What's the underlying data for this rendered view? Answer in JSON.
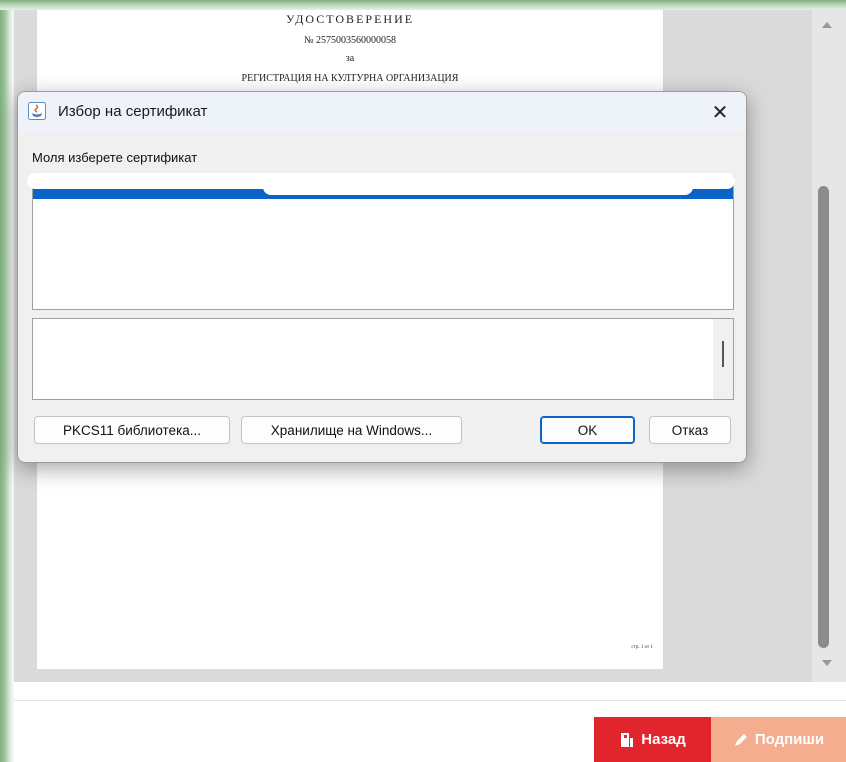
{
  "document": {
    "heading": "УДОСТОВЕРЕНИЕ",
    "number": "№ 2575003560000058",
    "preposition": "за",
    "subject": "РЕГИСТРАЦИЯ НА КУЛТУРНА ОРГАНИЗАЦИЯ",
    "page_counter": "стр. 1 от 1"
  },
  "dialog": {
    "title": "Избор на сертификат",
    "close_label": "✕",
    "prompt": "Моля изберете сертификат",
    "buttons": {
      "pkcs": "PKCS11 библиотека...",
      "store": "Хранилище на Windows...",
      "ok": "OK",
      "cancel": "Отказ"
    }
  },
  "actions": {
    "back_label": "Назад",
    "sign_label": "Подпиши"
  },
  "colors": {
    "back_button": "#e0262c",
    "sign_button": "#f4ad8e",
    "selection": "#0a64c8"
  },
  "icons": {
    "title": "java-cup-icon",
    "back": "door-exit-icon",
    "sign": "pen-icon"
  }
}
